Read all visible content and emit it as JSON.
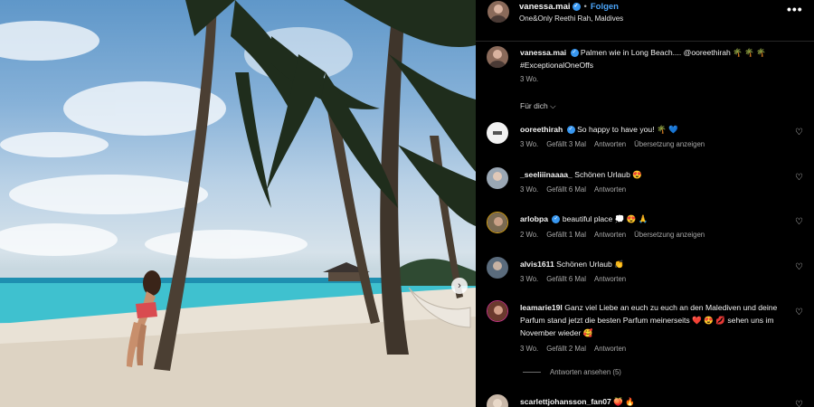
{
  "post": {
    "username": "vanessa.mai",
    "follow_label": "Folgen",
    "separator": "•",
    "location": "One&Only Reethi Rah, Maldives",
    "more_label": "•••",
    "carousel_next_glyph": "›"
  },
  "caption": {
    "username": "vanessa.mai",
    "text": "Palmen wie in Long Beach.... @ooreethirah 🌴 🌴 🌴 #ExceptionalOneOffs",
    "time": "3 Wo."
  },
  "for_you_label": "Für dich ⌵",
  "comments": [
    {
      "username": "ooreethirah",
      "verified": true,
      "text": "So happy to have you! 🌴 💙",
      "time": "3 Wo.",
      "likes": "Gefällt 3 Mal",
      "reply": "Antworten",
      "translate": "Übersetzung anzeigen",
      "avatar_color": "#f2f2f2"
    },
    {
      "username": "_seeliiinaaaa_",
      "verified": false,
      "text": "Schönen Urlaub 😍",
      "time": "3 Wo.",
      "likes": "Gefällt 6 Mal",
      "reply": "Antworten",
      "translate": "",
      "avatar_color": "#9aa7b4"
    },
    {
      "username": "arlobpa",
      "verified": true,
      "text": "beautiful place 💭 😍 🙏",
      "time": "2 Wo.",
      "likes": "Gefällt 1 Mal",
      "reply": "Antworten",
      "translate": "Übersetzung anzeigen",
      "avatar_color": "#7a6a52"
    },
    {
      "username": "alvis1611",
      "verified": false,
      "text": "Schönen Urlaub 👏",
      "time": "3 Wo.",
      "likes": "Gefällt 6 Mal",
      "reply": "Antworten",
      "translate": "",
      "avatar_color": "#5a6b7c"
    },
    {
      "username": "leamarie19l",
      "verified": false,
      "text": "Ganz viel Liebe an euch zu euch an den Malediven und deine Parfum stand jetzt die besten Parfum meinerseits ❤️ 😍 💋 sehen uns im November wieder 🥰",
      "time": "3 Wo.",
      "likes": "Gefällt 2 Mal",
      "reply": "Antworten",
      "translate": "",
      "avatar_color": "#6b3a2e"
    },
    {
      "username": "scarlettjohansson_fan07",
      "verified": false,
      "text": "🍑 🔥",
      "time": "",
      "likes": "",
      "reply": "",
      "translate": "",
      "avatar_color": "#c9b8a8"
    }
  ],
  "view_replies_label": "Antworten ansehen (5)",
  "colors": {
    "accent": "#4aa3f7",
    "verified": "#3897f0",
    "background": "#000000",
    "meta": "#a8a8a8"
  },
  "icons": {
    "heart": "heart-icon",
    "more": "more-options-icon",
    "verified": "verified-badge-icon"
  }
}
